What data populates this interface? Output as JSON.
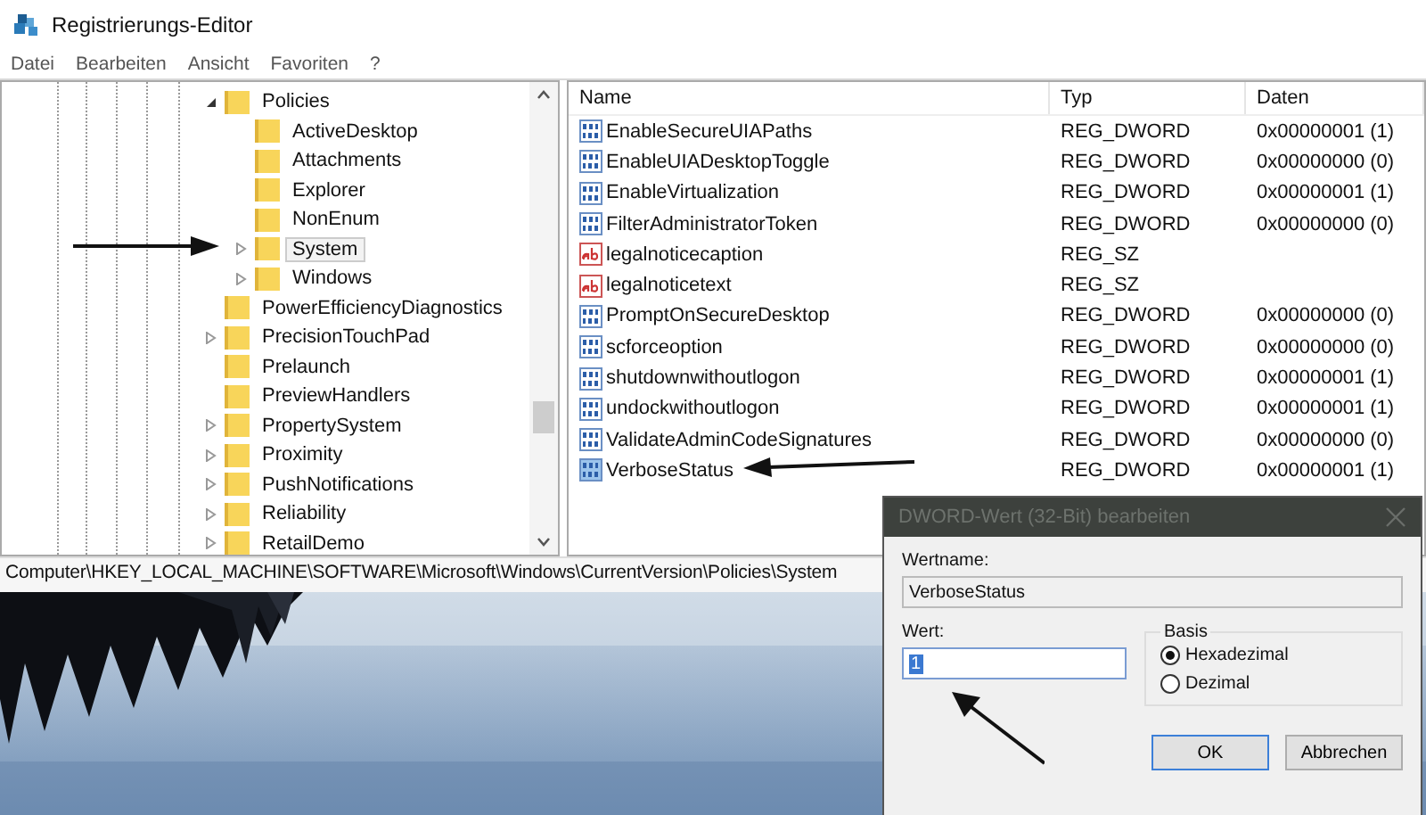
{
  "window": {
    "title": "Registrierungs-Editor"
  },
  "menu": [
    {
      "label": "Datei"
    },
    {
      "label": "Bearbeiten"
    },
    {
      "label": "Ansicht"
    },
    {
      "label": "Favoriten"
    },
    {
      "label": "?"
    }
  ],
  "tree": [
    {
      "label": "Policies",
      "expandable": true,
      "expanded": true,
      "selected": false,
      "children": [
        {
          "label": "ActiveDesktop",
          "expandable": false,
          "selected": false
        },
        {
          "label": "Attachments",
          "expandable": false,
          "selected": false
        },
        {
          "label": "Explorer",
          "expandable": false,
          "selected": false
        },
        {
          "label": "NonEnum",
          "expandable": false,
          "selected": false
        },
        {
          "label": "System",
          "expandable": true,
          "expanded": false,
          "selected": true
        },
        {
          "label": "Windows",
          "expandable": true,
          "expanded": false,
          "selected": false
        }
      ]
    },
    {
      "label": "PowerEfficiencyDiagnostics",
      "expandable": false,
      "selected": false
    },
    {
      "label": "PrecisionTouchPad",
      "expandable": true,
      "expanded": false,
      "selected": false
    },
    {
      "label": "Prelaunch",
      "expandable": false,
      "selected": false
    },
    {
      "label": "PreviewHandlers",
      "expandable": false,
      "selected": false
    },
    {
      "label": "PropertySystem",
      "expandable": true,
      "expanded": false,
      "selected": false
    },
    {
      "label": "Proximity",
      "expandable": true,
      "expanded": false,
      "selected": false
    },
    {
      "label": "PushNotifications",
      "expandable": true,
      "expanded": false,
      "selected": false
    },
    {
      "label": "Reliability",
      "expandable": true,
      "expanded": false,
      "selected": false
    },
    {
      "label": "RetailDemo",
      "expandable": true,
      "expanded": false,
      "selected": false
    }
  ],
  "table": {
    "columns": [
      "Name",
      "Typ",
      "Daten"
    ],
    "rows": [
      {
        "kind": "binary",
        "name": "EnableSecureUIAPaths",
        "type": "REG_DWORD",
        "data": "0x00000001 (1)",
        "selected": false
      },
      {
        "kind": "binary",
        "name": "EnableUIADesktopToggle",
        "type": "REG_DWORD",
        "data": "0x00000000 (0)",
        "selected": false
      },
      {
        "kind": "binary",
        "name": "EnableVirtualization",
        "type": "REG_DWORD",
        "data": "0x00000001 (1)",
        "selected": false
      },
      {
        "kind": "binary",
        "name": "FilterAdministratorToken",
        "type": "REG_DWORD",
        "data": "0x00000000 (0)",
        "selected": false
      },
      {
        "kind": "string",
        "name": "legalnoticecaption",
        "type": "REG_SZ",
        "selected": false
      },
      {
        "kind": "string",
        "name": "legalnoticetext",
        "type": "REG_SZ",
        "selected": false
      },
      {
        "kind": "binary",
        "name": "PromptOnSecureDesktop",
        "type": "REG_DWORD",
        "data": "0x00000000 (0)",
        "selected": false
      },
      {
        "kind": "binary",
        "name": "scforceoption",
        "type": "REG_DWORD",
        "data": "0x00000000 (0)",
        "selected": false
      },
      {
        "kind": "binary",
        "name": "shutdownwithoutlogon",
        "type": "REG_DWORD",
        "data": "0x00000001 (1)",
        "selected": false
      },
      {
        "kind": "binary",
        "name": "undockwithoutlogon",
        "type": "REG_DWORD",
        "data": "0x00000001 (1)",
        "selected": false
      },
      {
        "kind": "binary",
        "name": "ValidateAdminCodeSignatures",
        "type": "REG_DWORD",
        "data": "0x00000000 (0)",
        "selected": false
      },
      {
        "kind": "binary",
        "name": "VerboseStatus",
        "type": "REG_DWORD",
        "data": "0x00000001 (1)",
        "selected": true
      }
    ]
  },
  "status_bar": "Computer\\HKEY_LOCAL_MACHINE\\SOFTWARE\\Microsoft\\Windows\\CurrentVersion\\Policies\\System",
  "dialog": {
    "title": "DWORD-Wert (32-Bit) bearbeiten",
    "name_label": "Wertname:",
    "name_value": "VerboseStatus",
    "value_label": "Wert:",
    "value": "1",
    "base_label": "Basis",
    "bases": [
      {
        "label": "Hexadezimal",
        "selected": true
      },
      {
        "label": "Dezimal",
        "selected": false
      }
    ],
    "buttons": [
      {
        "label": "OK",
        "default": true
      },
      {
        "label": "Abbrechen",
        "default": false
      }
    ]
  }
}
